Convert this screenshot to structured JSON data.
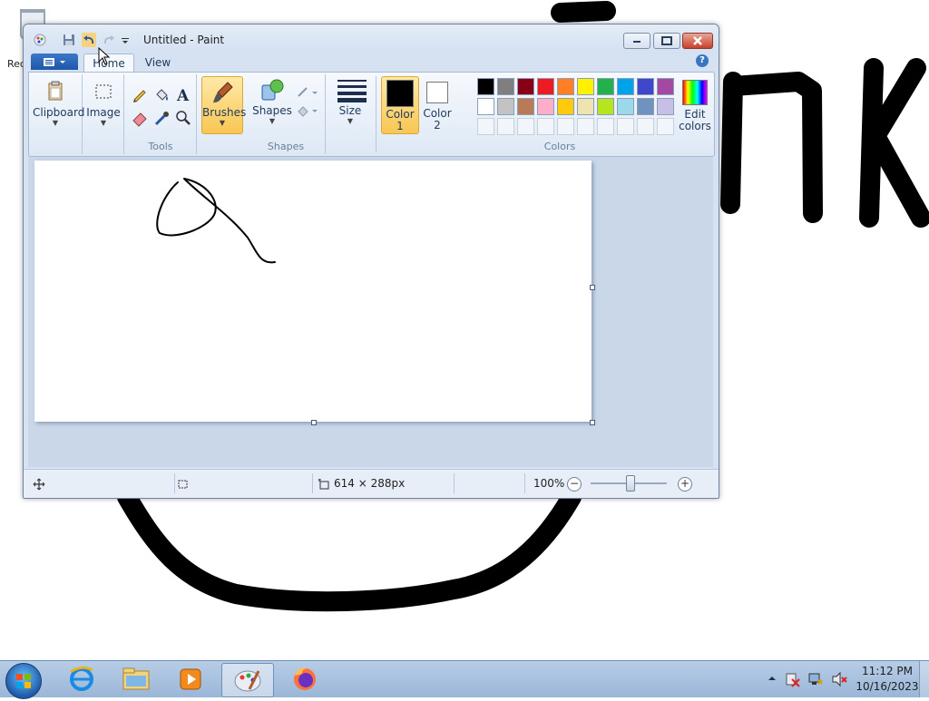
{
  "desktop": {
    "recycle_bin_label": "Rec"
  },
  "window": {
    "title": "Untitled - Paint"
  },
  "tabs": {
    "home": "Home",
    "view": "View"
  },
  "help_glyph": "?",
  "ribbon": {
    "clipboard": {
      "label": "Clipboard"
    },
    "image": {
      "label": "Image"
    },
    "tools": {
      "group_label": "Tools"
    },
    "brushes": {
      "label": "Brushes"
    },
    "shapes": {
      "label": "Shapes",
      "group_label": "Shapes"
    },
    "size": {
      "label": "Size"
    },
    "color1": {
      "label_line1": "Color",
      "label_line2": "1",
      "color": "#000000"
    },
    "color2": {
      "label_line1": "Color",
      "label_line2": "2",
      "color": "#ffffff"
    },
    "colors": {
      "group_label": "Colors"
    },
    "edit_colors": {
      "label_line1": "Edit",
      "label_line2": "colors"
    },
    "palette": [
      "#000000",
      "#7f7f7f",
      "#880015",
      "#ed1c24",
      "#ff7f27",
      "#fff200",
      "#22b14c",
      "#00a2e8",
      "#3f48cc",
      "#a349a4",
      "#ffffff",
      "#c3c3c3",
      "#b97a57",
      "#ffaec9",
      "#ffc90e",
      "#efe4b0",
      "#b5e61d",
      "#99d9ea",
      "#7092be",
      "#c8bfe7"
    ]
  },
  "statusbar": {
    "canvas_size": "614 × 288px",
    "zoom": "100%",
    "zoom_out": "−",
    "zoom_in": "+"
  },
  "taskbar": {
    "time": "11:12 PM",
    "date": "10/16/2023"
  }
}
